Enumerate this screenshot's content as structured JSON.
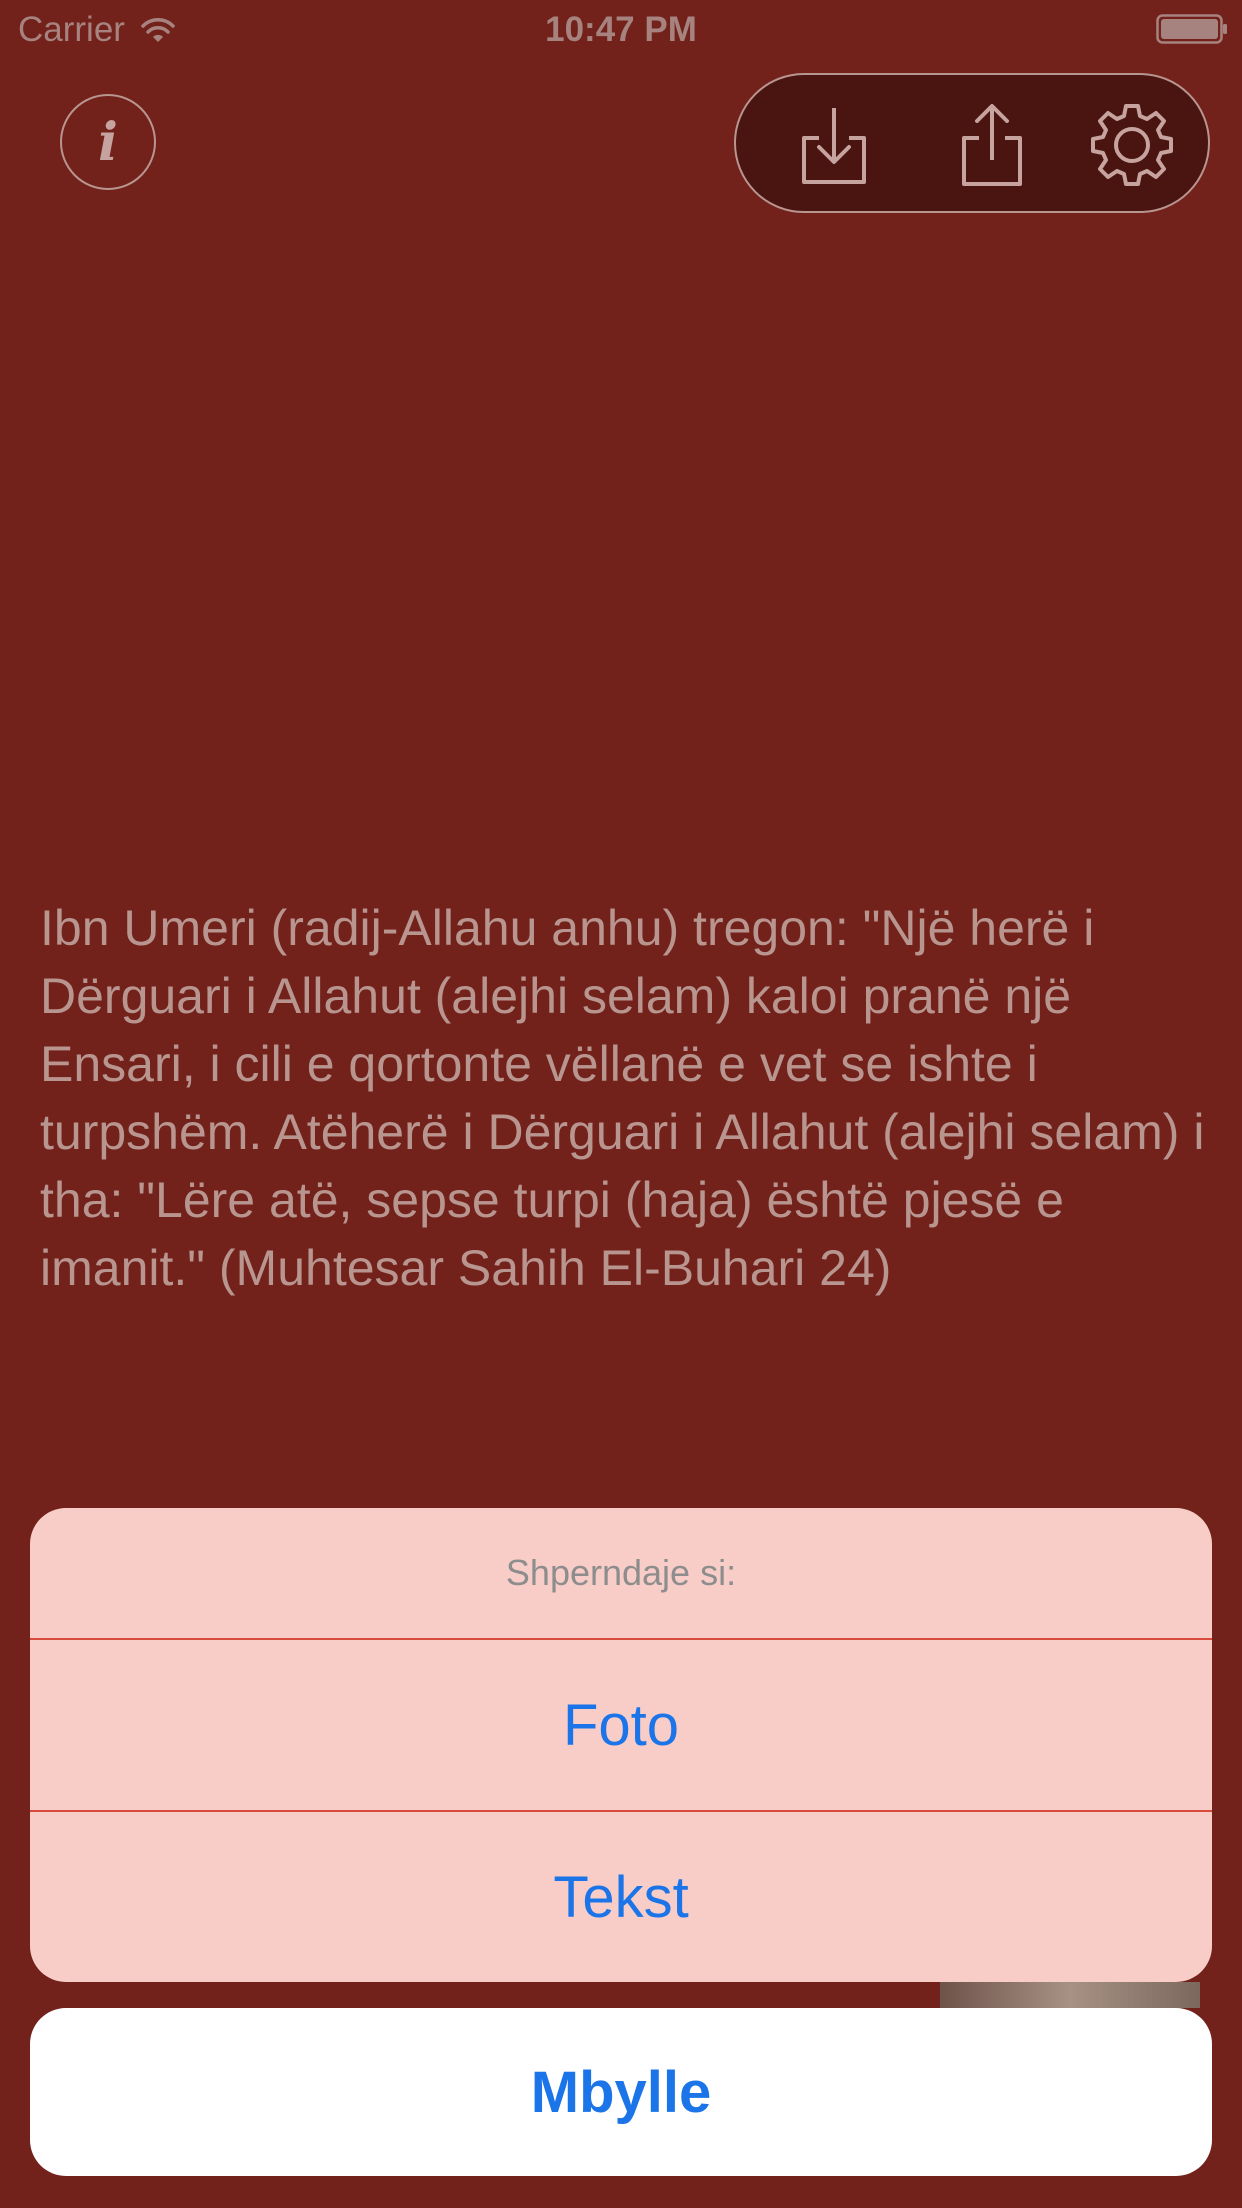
{
  "status_bar": {
    "carrier": "Carrier",
    "time": "10:47 PM"
  },
  "icons": {
    "info": "info-icon",
    "download": "download-icon",
    "share": "share-icon",
    "settings": "gear-icon",
    "wifi": "wifi-icon",
    "battery": "battery-icon"
  },
  "info_button": {
    "glyph": "i"
  },
  "quote": {
    "text": "Ibn Umeri (radij-Allahu anhu) tregon: \"Një herë i Dërguari i Allahut (alejhi selam) kaloi pranë një Ensari, i cili e qortonte vëllanë e vet se ishte i turpshëm. Atëherë i Dërguari i Allahut (alejhi selam) i tha: \"Lëre atë, sepse turpi (haja) është pjesë e imanit.\" (Muhtesar Sahih El-Buhari 24)"
  },
  "action_sheet": {
    "title": "Shperndaje si:",
    "options": [
      "Foto",
      "Tekst"
    ],
    "cancel": "Mbylle"
  },
  "colors": {
    "background": "#72211b",
    "sheet": "#f8cdc8",
    "action_text": "#1b74e8",
    "separator": "#d94b3d"
  }
}
